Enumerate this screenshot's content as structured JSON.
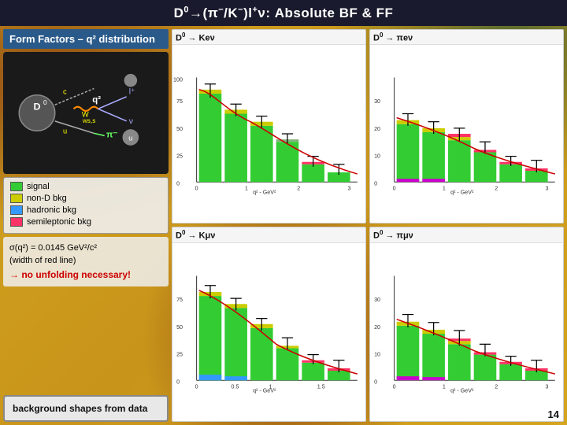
{
  "title": {
    "prefix": "D",
    "sup_d": "0",
    "arrow": "→",
    "bracket": "(π",
    "sup_pi": "-",
    "slash": "/K",
    "sup_k": "-",
    "close": ")l",
    "sup_l": "+",
    "nu": "ν",
    "colon": ": Absolute BF & FF"
  },
  "title_full": "D⁰→(π⁻/K⁻)l⁺ν: Absolute BF & FF",
  "form_factors_label": "Form Factors – q² distribution",
  "chart_labels": {
    "top_left": "D⁰ → Keν",
    "top_right": "D⁰ → πeν",
    "bottom_left": "D⁰ → Kμν",
    "bottom_right": "D⁰ → πμν"
  },
  "legend": {
    "signal_label": "signal",
    "signal_color": "#33cc33",
    "non_d_bkg_label": "non-D bkg",
    "non_d_bkg_color": "#cccc00",
    "hadronic_bkg_label": "hadronic bkg",
    "hadronic_bkg_color": "#3399ff",
    "semileptonic_bkg_label": "semileptonic bkg",
    "semileptonic_bkg_color": "#ff3366"
  },
  "sigma_text": "σ(q²) = 0.0145 GeV²/c²",
  "width_text": "(width of red line)",
  "no_unfolding": "→ no unfolding necessary!",
  "bg_shapes_label": "background shapes from data",
  "page_number": "14",
  "axis_label": "q² - GeV²"
}
